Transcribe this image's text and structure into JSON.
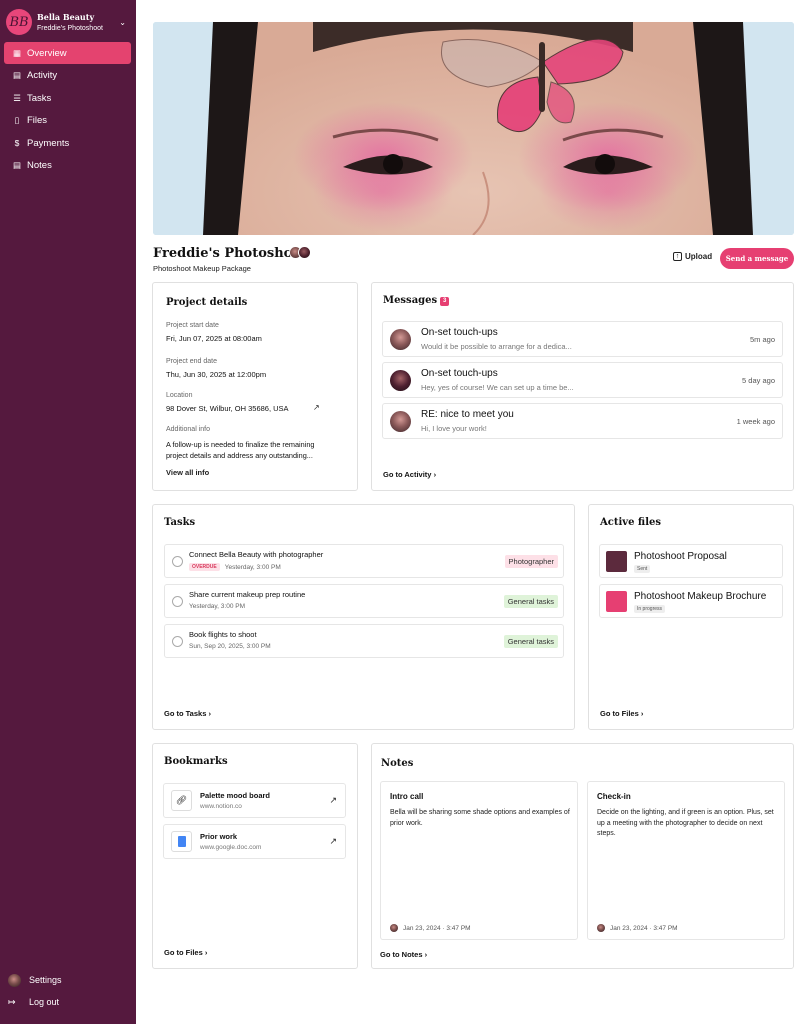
{
  "brand": {
    "logo_text": "BB",
    "name": "Bella Beauty",
    "project": "Freddie's Photoshoot"
  },
  "nav": [
    {
      "label": "Overview",
      "icon": "grid-icon"
    },
    {
      "label": "Activity",
      "icon": "chat-icon"
    },
    {
      "label": "Tasks",
      "icon": "list-icon"
    },
    {
      "label": "Files",
      "icon": "file-icon"
    },
    {
      "label": "Payments",
      "icon": "dollar-icon"
    },
    {
      "label": "Notes",
      "icon": "note-icon"
    }
  ],
  "sidebar_bottom": {
    "settings": "Settings",
    "logout": "Log out"
  },
  "header": {
    "title": "Freddie's Photoshoot",
    "subtitle": "Photoshoot Makeup Package",
    "upload": "Upload",
    "send_message": "Send a message"
  },
  "project_details": {
    "title": "Project details",
    "start_label": "Project start date",
    "start_value": "Fri, Jun 07, 2025 at 08:00am",
    "end_label": "Project end date",
    "end_value": "Thu, Jun 30, 2025 at 12:00pm",
    "location_label": "Location",
    "location_value": "98 Dover St, Wilbur, OH 35686, USA",
    "info_label": "Additional info",
    "info_value": "A follow-up is needed to finalize the remaining project details and address any outstanding...",
    "view_all": "View all info"
  },
  "messages": {
    "title": "Messages",
    "count": "3",
    "items": [
      {
        "title": "On-set touch-ups",
        "preview": "Would it be possible to arrange for a dedica...",
        "time": "5m ago"
      },
      {
        "title": "On-set touch-ups",
        "preview": "Hey, yes of course! We can set up a time be...",
        "time": "5 day ago"
      },
      {
        "title": "RE: nice to meet you",
        "preview": "Hi, I love your work!",
        "time": "1 week ago"
      }
    ],
    "go_link": "Go to Activity"
  },
  "tasks": {
    "title": "Tasks",
    "overdue_label": "OVERDUE",
    "items": [
      {
        "title": "Connect Bella Beauty with photographer",
        "due": "Yesterday, 3:00 PM",
        "tag": "Photographer"
      },
      {
        "title": "Share current makeup prep routine",
        "due": "Yesterday, 3:00 PM",
        "tag": "General tasks"
      },
      {
        "title": "Book flights to shoot",
        "due": "Sun, Sep 20, 2025, 3:00 PM",
        "tag": "General tasks"
      }
    ],
    "go_link": "Go to Tasks"
  },
  "active_files": {
    "title": "Active files",
    "items": [
      {
        "title": "Photoshoot Proposal",
        "status": "Sent",
        "color": "#5c2a3d"
      },
      {
        "title": "Photoshoot Makeup Brochure",
        "status": "In progress",
        "color": "#e63f72"
      }
    ],
    "go_link": "Go to Files"
  },
  "bookmarks": {
    "title": "Bookmarks",
    "items": [
      {
        "title": "Palette mood board",
        "url": "www.notion.co",
        "icon": "link-icon"
      },
      {
        "title": "Prior work",
        "url": "www.google.doc.com",
        "icon": "google-doc-icon"
      }
    ],
    "go_link": "Go to Files"
  },
  "notes": {
    "title": "Notes",
    "items": [
      {
        "title": "Intro call",
        "body": "Bella will be sharing some shade options and examples of prior work.",
        "date": "Jan 23, 2024 · 3:47 PM"
      },
      {
        "title": "Check-in",
        "body": "Decide on the lighting, and if green is an option. Plus, set up a meeting with the photographer to decide on next steps.",
        "date": "Jan 23, 2024 · 3:47 PM"
      }
    ],
    "go_link": "Go to Notes"
  },
  "colors": {
    "sidebar": "#55193e",
    "accent": "#e63f72"
  }
}
